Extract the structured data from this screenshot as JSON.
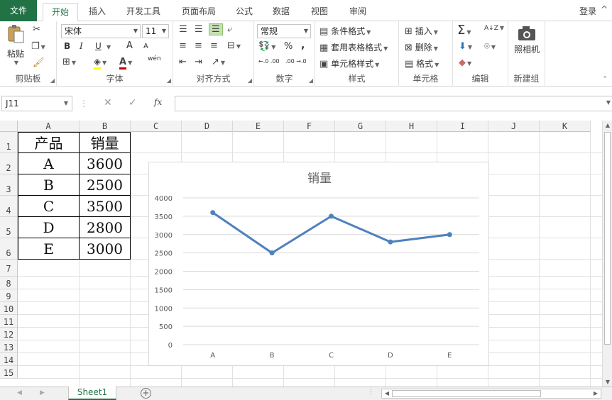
{
  "tabs": {
    "file": "文件",
    "items": [
      "开始",
      "插入",
      "开发工具",
      "页面布局",
      "公式",
      "数据",
      "视图",
      "审阅"
    ],
    "login": "登录"
  },
  "ribbon": {
    "clipboard": {
      "label": "剪贴板",
      "paste": "粘贴"
    },
    "font": {
      "label": "字体",
      "font_name": "宋体",
      "font_size": "11",
      "bold": "B",
      "italic": "I",
      "underline": "U",
      "grow": "A",
      "shrink": "A",
      "phonetic": "wén"
    },
    "alignment": {
      "label": "对齐方式"
    },
    "number": {
      "label": "数字",
      "format": "常规",
      "percent": "%",
      "comma": ",",
      "inc_decimal": "←.0 .00",
      "dec_decimal": ".00 →.0"
    },
    "styles": {
      "label": "样式",
      "conditional": "条件格式",
      "table_format": "套用表格格式",
      "cell_styles": "单元格样式"
    },
    "cells": {
      "label": "单元格",
      "insert": "插入",
      "delete": "删除",
      "format": "格式"
    },
    "editing": {
      "label": "编辑",
      "sum": "Σ",
      "sort": "A↓Z"
    },
    "newgroup": {
      "label": "新建组",
      "camera": "照相机"
    }
  },
  "formula_bar": {
    "name_box": "J11",
    "fx": "fx",
    "cancel": "✕",
    "enter": "✓",
    "value": ""
  },
  "columns": [
    "A",
    "B",
    "C",
    "D",
    "E",
    "F",
    "G",
    "H",
    "I",
    "J",
    "K"
  ],
  "rows": [
    "1",
    "2",
    "3",
    "4",
    "5",
    "6",
    "7",
    "8",
    "9",
    "10",
    "11",
    "12",
    "13",
    "14",
    "15"
  ],
  "table": {
    "header": [
      "产品",
      "销量"
    ],
    "rows": [
      [
        "A",
        "3600"
      ],
      [
        "B",
        "2500"
      ],
      [
        "C",
        "3500"
      ],
      [
        "D",
        "2800"
      ],
      [
        "E",
        "3000"
      ]
    ]
  },
  "sheets": {
    "active": "Sheet1",
    "add": "+"
  },
  "chart_data": {
    "type": "line",
    "title": "销量",
    "categories": [
      "A",
      "B",
      "C",
      "D",
      "E"
    ],
    "series": [
      {
        "name": "销量",
        "values": [
          3600,
          2500,
          3500,
          2800,
          3000
        ],
        "color": "#4f81bd"
      }
    ],
    "ylim": [
      0,
      4000
    ],
    "yticks": [
      0,
      500,
      1000,
      1500,
      2000,
      2500,
      3000,
      3500,
      4000
    ],
    "xlabel": "",
    "ylabel": "",
    "grid": true,
    "legend": "none"
  },
  "colors": {
    "accent": "#217346",
    "series": "#4f81bd"
  }
}
